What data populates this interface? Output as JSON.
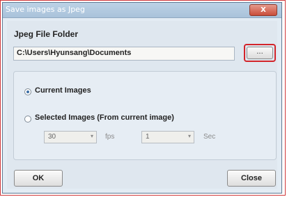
{
  "window": {
    "title": "Save images as Jpeg",
    "close_glyph": "X"
  },
  "folder": {
    "label": "Jpeg File Folder",
    "path": "C:\\Users\\Hyunsang\\Documents",
    "browse_label": "..."
  },
  "options": {
    "current_images_label": "Current Images",
    "current_images_selected": true,
    "selected_images_label": "Selected Images (From current image)",
    "selected_images_selected": false,
    "fps_value": "30",
    "fps_unit": "fps",
    "sec_value": "1",
    "sec_unit": "Sec",
    "dropdown_arrow": "▾"
  },
  "buttons": {
    "ok_label": "OK",
    "close_label": "Close"
  },
  "colors": {
    "highlight": "#d3242a"
  }
}
